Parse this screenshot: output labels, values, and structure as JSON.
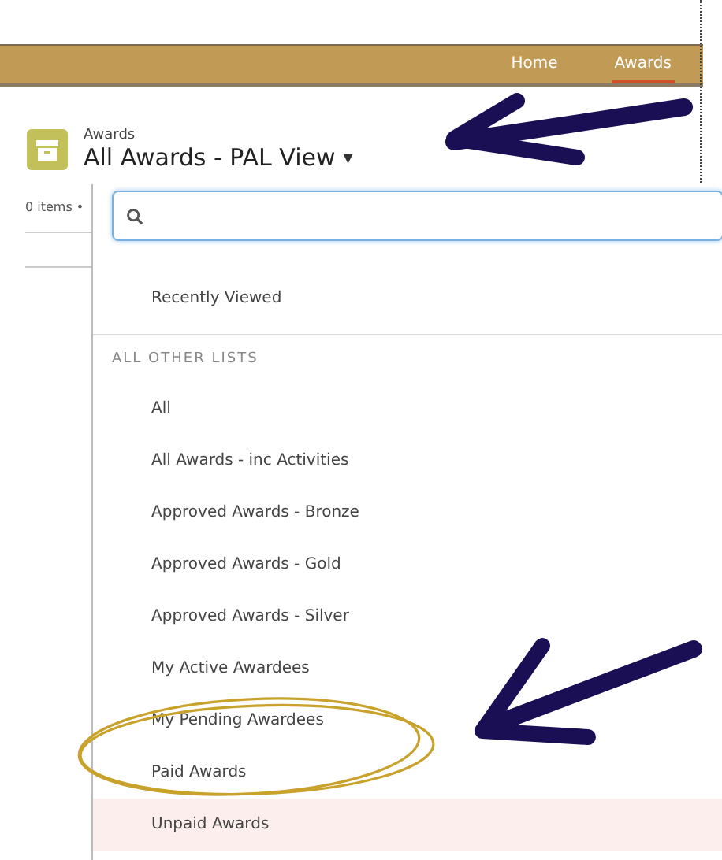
{
  "nav": {
    "tabs": [
      {
        "label": "Home",
        "selected": false
      },
      {
        "label": "Awards",
        "selected": true
      }
    ]
  },
  "header": {
    "object": "Awards",
    "title": "All Awards - PAL View",
    "caret": "▾"
  },
  "list_summary": "0 items •",
  "dropdown": {
    "recent": [
      {
        "label": "Recently Viewed",
        "highlighted": false
      }
    ],
    "section": "ALL OTHER LISTS",
    "items": [
      {
        "label": "All",
        "highlighted": false
      },
      {
        "label": "All Awards - inc Activities",
        "highlighted": false
      },
      {
        "label": "Approved Awards - Bronze",
        "highlighted": false
      },
      {
        "label": "Approved Awards - Gold",
        "highlighted": false
      },
      {
        "label": "Approved Awards - Silver",
        "highlighted": false
      },
      {
        "label": "My Active Awardees",
        "highlighted": false
      },
      {
        "label": "My Pending Awardees",
        "highlighted": false
      },
      {
        "label": "Paid Awards",
        "highlighted": false
      },
      {
        "label": "Unpaid Awards",
        "highlighted": true
      }
    ]
  }
}
